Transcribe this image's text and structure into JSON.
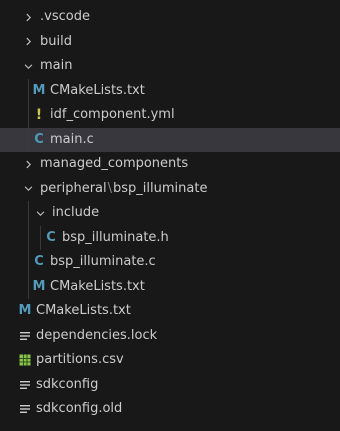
{
  "explorer": {
    "items": [
      {
        "label": ".vscode",
        "depth": 0,
        "kind": "folder",
        "expanded": false,
        "icon": "chevron-right-icon"
      },
      {
        "label": "build",
        "depth": 0,
        "kind": "folder",
        "expanded": false,
        "icon": "chevron-right-icon"
      },
      {
        "label": "main",
        "depth": 0,
        "kind": "folder",
        "expanded": true,
        "icon": "chevron-down-icon"
      },
      {
        "label": "CMakeLists.txt",
        "depth": 1,
        "kind": "file",
        "icon": "cmake-icon",
        "glyph": "M"
      },
      {
        "label": "idf_component.yml",
        "depth": 1,
        "kind": "file",
        "icon": "yaml-icon",
        "glyph": "!"
      },
      {
        "label": "main.c",
        "depth": 1,
        "kind": "file",
        "icon": "c-file-icon",
        "glyph": "C",
        "selected": true
      },
      {
        "label": "managed_components",
        "depth": 0,
        "kind": "folder",
        "expanded": false,
        "icon": "chevron-right-icon"
      },
      {
        "label": "peripheral",
        "label2": "bsp_illuminate",
        "separator": "\\",
        "depth": 0,
        "kind": "folder",
        "expanded": true,
        "icon": "chevron-down-icon"
      },
      {
        "label": "include",
        "depth": 1,
        "kind": "folder",
        "expanded": true,
        "icon": "chevron-down-icon"
      },
      {
        "label": "bsp_illuminate.h",
        "depth": 2,
        "kind": "file",
        "icon": "c-file-icon",
        "glyph": "C"
      },
      {
        "label": "bsp_illuminate.c",
        "depth": 1,
        "kind": "file",
        "icon": "c-file-icon",
        "glyph": "C"
      },
      {
        "label": "CMakeLists.txt",
        "depth": 1,
        "kind": "file",
        "icon": "cmake-icon",
        "glyph": "M"
      },
      {
        "label": "CMakeLists.txt",
        "depth": 0,
        "kind": "file",
        "icon": "cmake-icon",
        "glyph": "M"
      },
      {
        "label": "dependencies.lock",
        "depth": 0,
        "kind": "file",
        "icon": "lines-file-icon"
      },
      {
        "label": "partitions.csv",
        "depth": 0,
        "kind": "file",
        "icon": "csv-file-icon"
      },
      {
        "label": "sdkconfig",
        "depth": 0,
        "kind": "file",
        "icon": "lines-file-icon"
      },
      {
        "label": "sdkconfig.old",
        "depth": 0,
        "kind": "file",
        "icon": "lines-file-icon"
      }
    ]
  },
  "colors": {
    "background": "#181818",
    "text": "#cccccc",
    "selected_row": "#37373d",
    "cmake": "#519aba",
    "c_file": "#519aba",
    "yaml": "#cbcb41",
    "csv": "#89c34a",
    "lines": "#cccccc",
    "guide": "#3a3a3a"
  }
}
